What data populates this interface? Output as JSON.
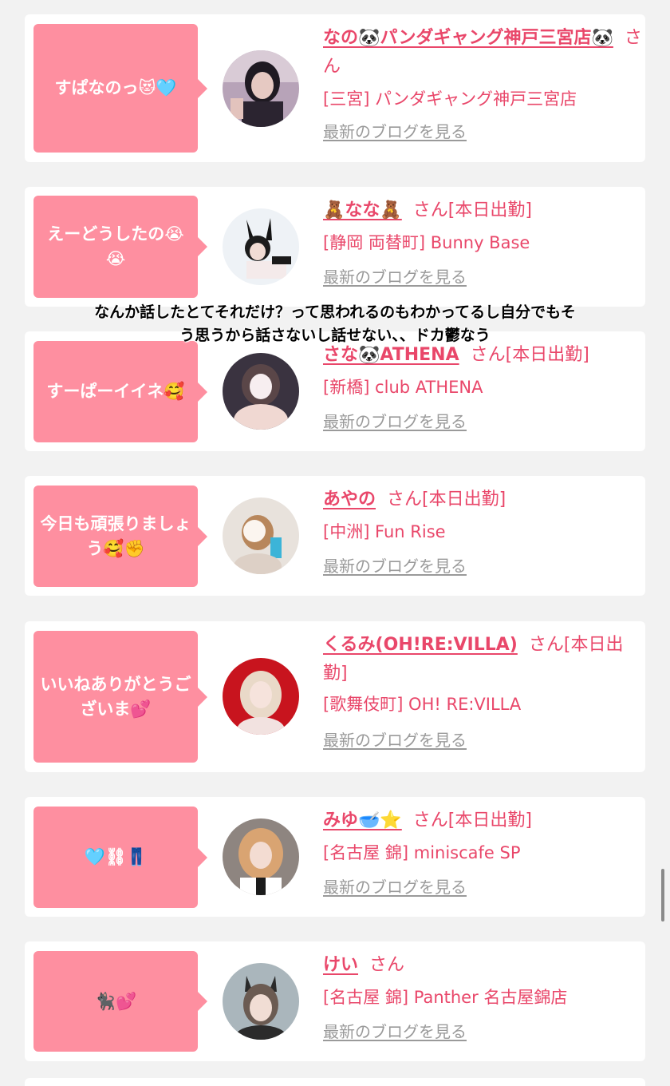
{
  "cards": [
    {
      "bubble": "すぱなのっ😻🩵",
      "name": "なの🐼パンダギャング神戸三宮店🐼",
      "san": "さん",
      "shop": "[三宮] パンダギャング神戸三宮店",
      "blog": "最新のブログを見る"
    },
    {
      "bubble": "えーどうしたの😭😭",
      "name": "🧸なな🧸",
      "san": "さん[本日出勤]",
      "shop": "[静岡 両替町] Bunny Base",
      "blog": "最新のブログを見る"
    },
    {
      "bubble": "すーぱーイイネ🥰",
      "name": "さな🐼ATHENA",
      "san": "さん[本日出勤]",
      "shop": "[新橋] club ATHENA",
      "blog": "最新のブログを見る"
    },
    {
      "bubble": "今日も頑張りましょう🥰✊",
      "name": "あやの",
      "san": "さん[本日出勤]",
      "shop": "[中洲] Fun Rise",
      "blog": "最新のブログを見る"
    },
    {
      "bubble": "いいねありがとうございま💕",
      "name": "くるみ(OH!RE:VILLA)",
      "san": "さん[本日出勤]",
      "shop": "[歌舞伎町] OH! RE:VILLA",
      "blog": "最新のブログを見る"
    },
    {
      "bubble": "🩵⛓👖",
      "name": "みゆ🥣⭐",
      "san": "さん[本日出勤]",
      "shop": "[名古屋 錦] miniscafe SP",
      "blog": "最新のブログを見る"
    },
    {
      "bubble": "🐈‍⬛💕",
      "name": "けい",
      "san": "さん",
      "shop": "[名古屋 錦] Panther 名古屋錦店",
      "blog": "最新のブログを見る"
    }
  ],
  "overlay": {
    "line1": "なんか話したとてそれだけ？って思われるのもわかってるし自分でもそ",
    "line2": "う思うから話さないし話せない、、ドカ鬱なう"
  },
  "colors": {
    "bubble": "#fe8fa0",
    "name": "#e9476a",
    "link": "#9a9a9a",
    "background": "#f2f2f2"
  }
}
